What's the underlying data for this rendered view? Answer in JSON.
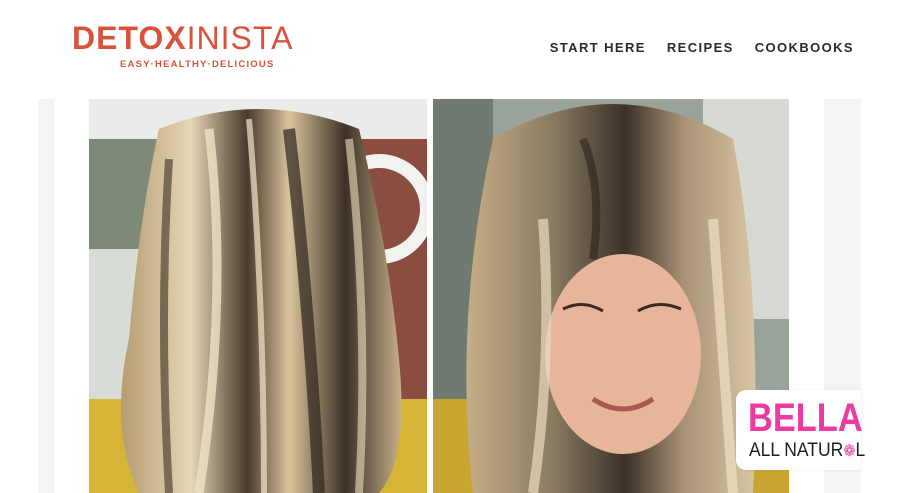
{
  "logo": {
    "name_bold": "DETOX",
    "name_light": "INISTA",
    "tagline": "EASY·HEALTHY·DELICIOUS",
    "color": "#d9533c"
  },
  "nav": {
    "items": [
      {
        "label": "START HERE"
      },
      {
        "label": "RECIPES"
      },
      {
        "label": "COOKBOOKS"
      }
    ]
  },
  "photos": {
    "left": {
      "subject": "back of head with long blonde-highlighted hair, yellow sweater"
    },
    "right": {
      "subject": "woman smiling looking down, highlighted hair, yellow sweater"
    }
  },
  "badge": {
    "title": "BELLA",
    "subtitle_before": "ALL NATUR",
    "subtitle_icon": "flower-icon",
    "subtitle_after": "L",
    "accent": "#ec3aa2"
  }
}
